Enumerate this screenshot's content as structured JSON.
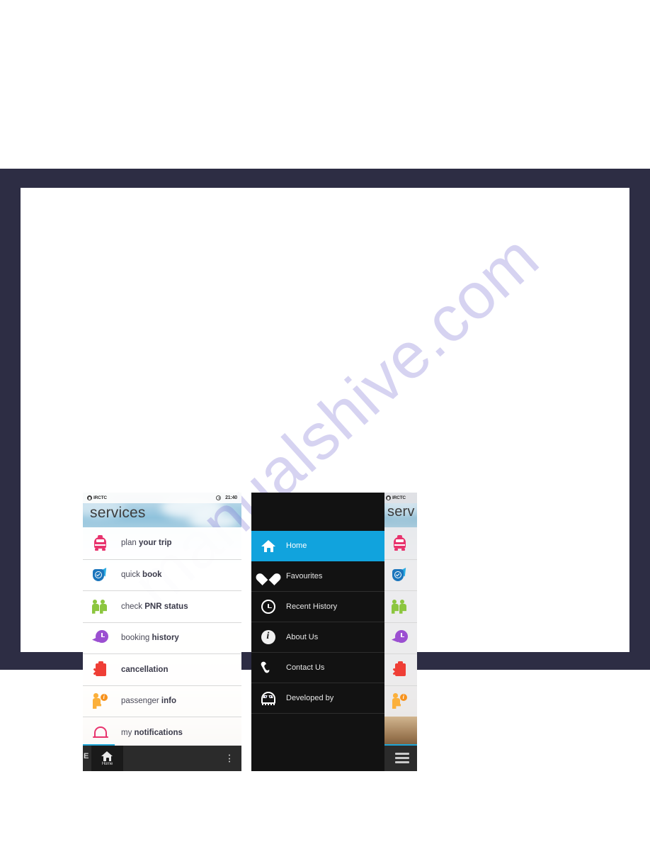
{
  "page": {
    "background_color": "#ffffff",
    "band_color": "#2d2d44",
    "page_color": "#ffffff",
    "watermark": "manualshive.com"
  },
  "left_phone": {
    "status_bar": {
      "brand": "IRCTC",
      "clock_icon": "clock-icon",
      "time": "21:40"
    },
    "title": "services",
    "services": [
      {
        "icon": "train-icon",
        "light": "plan ",
        "bold": "your trip"
      },
      {
        "icon": "quick-book-icon",
        "light": "quick ",
        "bold": "book"
      },
      {
        "icon": "passengers-icon",
        "light": "check ",
        "bold": "PNR status"
      },
      {
        "icon": "history-clock-icon",
        "light": "booking ",
        "bold": "history"
      },
      {
        "icon": "cancellation-icon",
        "light": "",
        "bold": "cancellation"
      },
      {
        "icon": "passenger-info-icon",
        "light": "passenger ",
        "bold": "info"
      },
      {
        "icon": "bell-icon",
        "light": "my ",
        "bold": "notifications"
      }
    ],
    "app_bar": {
      "edge_letter": "E",
      "home_icon": "home-icon",
      "home_label": "Home",
      "overflow_icon": "overflow-dots-icon"
    }
  },
  "right_phone": {
    "drawer": {
      "items": [
        {
          "icon": "home-icon",
          "label": "Home",
          "active": true
        },
        {
          "icon": "heart-icon",
          "label": "Favourites",
          "active": false
        },
        {
          "icon": "clock-icon",
          "label": "Recent History",
          "active": false
        },
        {
          "icon": "info-icon",
          "label": "About Us",
          "active": false
        },
        {
          "icon": "phone-icon",
          "label": "Contact Us",
          "active": false
        },
        {
          "icon": "ghost-icon",
          "label": "Developed by",
          "active": false
        }
      ],
      "active_color": "#11a3dd",
      "background_color": "#121212"
    },
    "peek": {
      "status_bar": {
        "brand": "IRCTC"
      },
      "title": "serv",
      "services": [
        {
          "icon": "train-icon"
        },
        {
          "icon": "quick-book-icon"
        },
        {
          "icon": "passengers-icon"
        },
        {
          "icon": "history-clock-icon"
        },
        {
          "icon": "cancellation-icon"
        },
        {
          "icon": "passenger-info-icon"
        }
      ],
      "menu_icon": "hamburger-icon"
    }
  }
}
